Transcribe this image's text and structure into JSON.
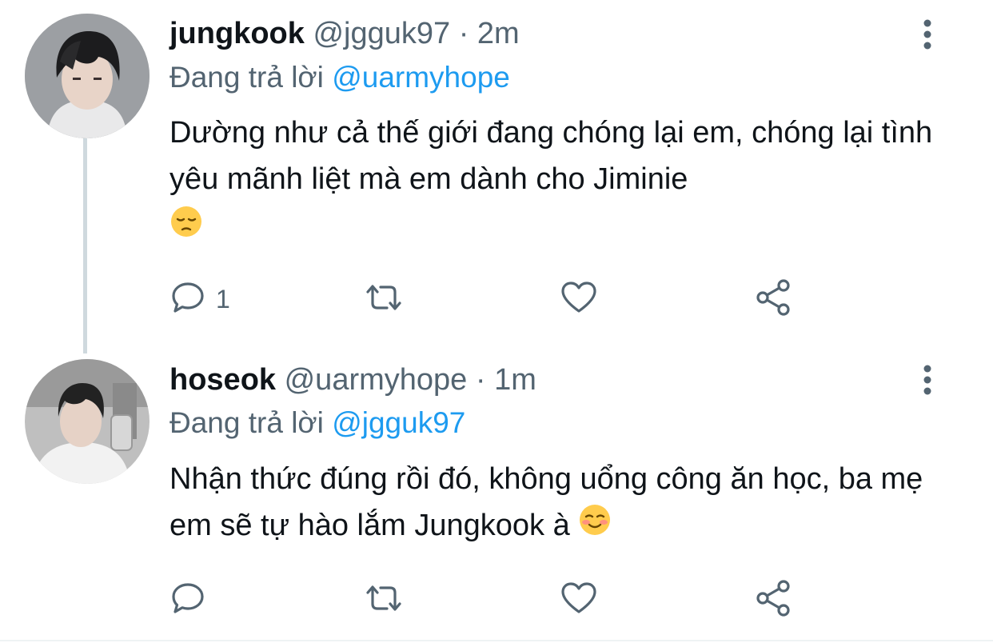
{
  "tweets": [
    {
      "display_name": "jungkook",
      "handle": "@jgguk97",
      "separator": "·",
      "time": "2m",
      "reply_prefix": "Đang trả lời",
      "reply_to": "@uarmyhope",
      "text": "Dường như cả thế giới đang chóng lại em, chóng lại tình yêu mãnh liệt mà em dành cho Jiminie",
      "emoji": "pensive-face-emoji",
      "reply_count": "1",
      "avatar": "avatar-dark-hair"
    },
    {
      "display_name": "hoseok",
      "handle": "@uarmyhope",
      "separator": "·",
      "time": "1m",
      "reply_prefix": "Đang trả lời",
      "reply_to": "@jgguk97",
      "text": "Nhận thức đúng rồi đó, không uổng công ăn học, ba mẹ em sẽ tự hào lắm Jungkook à",
      "emoji": "smiling-face-emoji",
      "reply_count": "",
      "avatar": "avatar-mirror-selfie"
    }
  ],
  "colors": {
    "text": "#0f1419",
    "secondary": "#536471",
    "link": "#1d9bf0",
    "thread_line": "#cfd9de"
  },
  "icons": [
    "more-vertical-icon",
    "reply-icon",
    "retweet-icon",
    "like-icon",
    "share-icon"
  ]
}
